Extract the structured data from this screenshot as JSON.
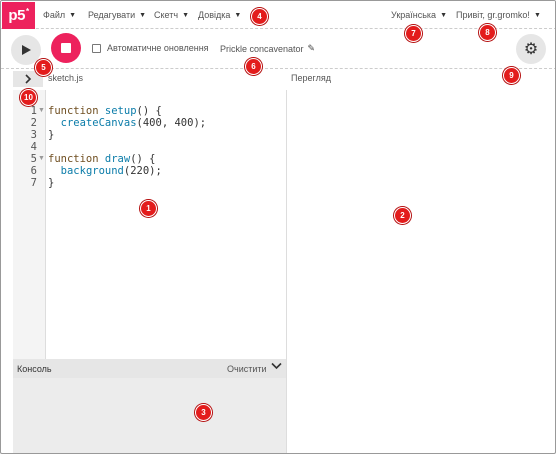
{
  "app": {
    "logo": "p5",
    "logo_sup": "*"
  },
  "menu": {
    "file": "Файл",
    "edit": "Редагувати",
    "sketch": "Скетч",
    "help": "Довідка",
    "language": "Українська",
    "user": "Привіт, gr.gromko!"
  },
  "toolbar": {
    "autorefresh_label": "Автоматичне оновлення",
    "sketch_name": "Prickle concavenator"
  },
  "editor": {
    "file_name": "sketch.js",
    "line_numbers": [
      "1",
      "2",
      "3",
      "4",
      "5",
      "6",
      "7"
    ]
  },
  "preview": {
    "label": "Перегляд"
  },
  "console": {
    "title": "Консоль",
    "clear_label": "Очистити"
  },
  "markers": [
    "1",
    "2",
    "3",
    "4",
    "5",
    "6",
    "7",
    "8",
    "9",
    "10"
  ],
  "colors": {
    "brand": "#ed225d",
    "marker": "#e31c1c",
    "keyword": "#704f21",
    "function": "#0b7ca9"
  },
  "icons": {
    "play": "play-icon",
    "stop": "stop-icon",
    "settings": "gear-icon",
    "edit": "pencil-icon",
    "sidebar": "chevron-right-icon",
    "console_toggle": "chevron-down-icon"
  }
}
